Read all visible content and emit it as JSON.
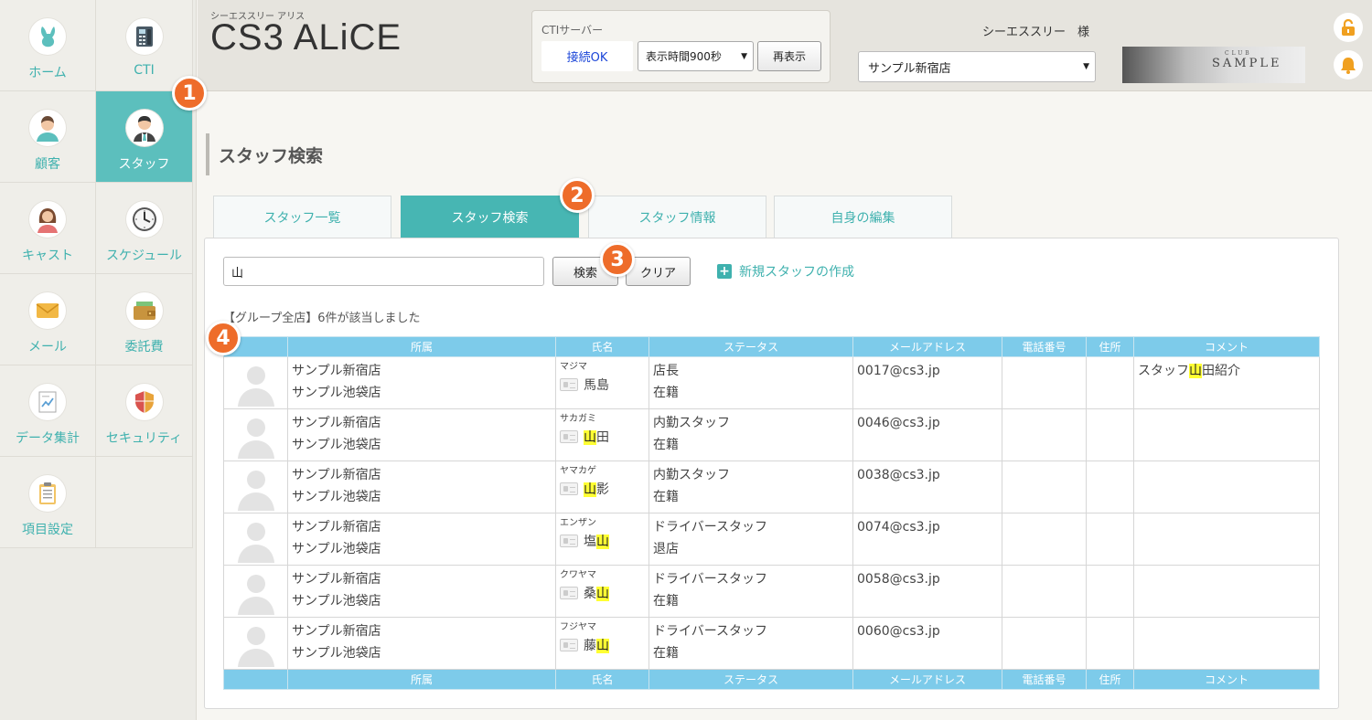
{
  "sidebar": {
    "items": [
      {
        "label": "ホーム",
        "icon": "rabbit-icon"
      },
      {
        "label": "CTI",
        "icon": "phone-icon"
      },
      {
        "label": "顧客",
        "icon": "customer-icon"
      },
      {
        "label": "スタッフ",
        "icon": "staff-icon",
        "active": true
      },
      {
        "label": "キャスト",
        "icon": "cast-icon"
      },
      {
        "label": "スケジュール",
        "icon": "clock-icon"
      },
      {
        "label": "メール",
        "icon": "mail-icon"
      },
      {
        "label": "委託費",
        "icon": "wallet-icon"
      },
      {
        "label": "データ集計",
        "icon": "report-icon"
      },
      {
        "label": "セキュリティ",
        "icon": "shield-icon"
      },
      {
        "label": "項目設定",
        "icon": "clipboard-icon"
      }
    ]
  },
  "header": {
    "subtitle": "シーエススリー アリス",
    "title": "CS3 ALiCE",
    "cti": {
      "label": "CTIサーバー",
      "status": "接続OK",
      "display_time": "表示時間900秒",
      "refresh_label": "再表示"
    },
    "user_name": "シーエススリー　様",
    "shop": "サンプル新宿店",
    "banner_top": "CLUB",
    "banner_text": "SAMPLE"
  },
  "page": {
    "title": "スタッフ検索",
    "tabs": [
      "スタッフ一覧",
      "スタッフ検索",
      "スタッフ情報",
      "自身の編集"
    ],
    "active_tab": 1
  },
  "search": {
    "value": "山",
    "search_label": "検索",
    "clear_label": "クリア",
    "new_staff_label": "新規スタッフの作成"
  },
  "results": {
    "count_text": "【グループ全店】6件が該当しました",
    "columns": [
      "",
      "所属",
      "氏名",
      "ステータス",
      "メールアドレス",
      "電話番号",
      "住所",
      "コメント"
    ],
    "rows": [
      {
        "shops": [
          "サンプル新宿店",
          "サンプル池袋店"
        ],
        "kana": "マジマ",
        "name_pre": "馬島",
        "name_hl": "",
        "name_post": "",
        "status": [
          "店長",
          "在籍"
        ],
        "email": "0017@cs3.jp",
        "phone": "",
        "address": "",
        "comment_pre": "スタッフ",
        "comment_hl": "山",
        "comment_post": "田紹介"
      },
      {
        "shops": [
          "サンプル新宿店",
          "サンプル池袋店"
        ],
        "kana": "サカガミ",
        "name_pre": "",
        "name_hl": "山",
        "name_post": "田",
        "status": [
          "内勤スタッフ",
          "在籍"
        ],
        "email": "0046@cs3.jp",
        "phone": "",
        "address": "",
        "comment_pre": "",
        "comment_hl": "",
        "comment_post": ""
      },
      {
        "shops": [
          "サンプル新宿店",
          "サンプル池袋店"
        ],
        "kana": "ヤマカゲ",
        "name_pre": "",
        "name_hl": "山",
        "name_post": "影",
        "status": [
          "内勤スタッフ",
          "在籍"
        ],
        "email": "0038@cs3.jp",
        "phone": "",
        "address": "",
        "comment_pre": "",
        "comment_hl": "",
        "comment_post": ""
      },
      {
        "shops": [
          "サンプル新宿店",
          "サンプル池袋店"
        ],
        "kana": "エンザン",
        "name_pre": "塩",
        "name_hl": "山",
        "name_post": "",
        "status": [
          "ドライバースタッフ",
          "退店"
        ],
        "email": "0074@cs3.jp",
        "phone": "",
        "address": "",
        "comment_pre": "",
        "comment_hl": "",
        "comment_post": ""
      },
      {
        "shops": [
          "サンプル新宿店",
          "サンプル池袋店"
        ],
        "kana": "クワヤマ",
        "name_pre": "桑",
        "name_hl": "山",
        "name_post": "",
        "status": [
          "ドライバースタッフ",
          "在籍"
        ],
        "email": "0058@cs3.jp",
        "phone": "",
        "address": "",
        "comment_pre": "",
        "comment_hl": "",
        "comment_post": ""
      },
      {
        "shops": [
          "サンプル新宿店",
          "サンプル池袋店"
        ],
        "kana": "フジヤマ",
        "name_pre": "藤",
        "name_hl": "山",
        "name_post": "",
        "status": [
          "ドライバースタッフ",
          "在籍"
        ],
        "email": "0060@cs3.jp",
        "phone": "",
        "address": "",
        "comment_pre": "",
        "comment_hl": "",
        "comment_post": ""
      }
    ]
  },
  "badges": [
    "1",
    "2",
    "3",
    "4"
  ],
  "colors": {
    "accent": "#47b6b3",
    "table_header": "#7dcbea",
    "badge": "#ee6c2a",
    "highlight": "#ffff33"
  }
}
